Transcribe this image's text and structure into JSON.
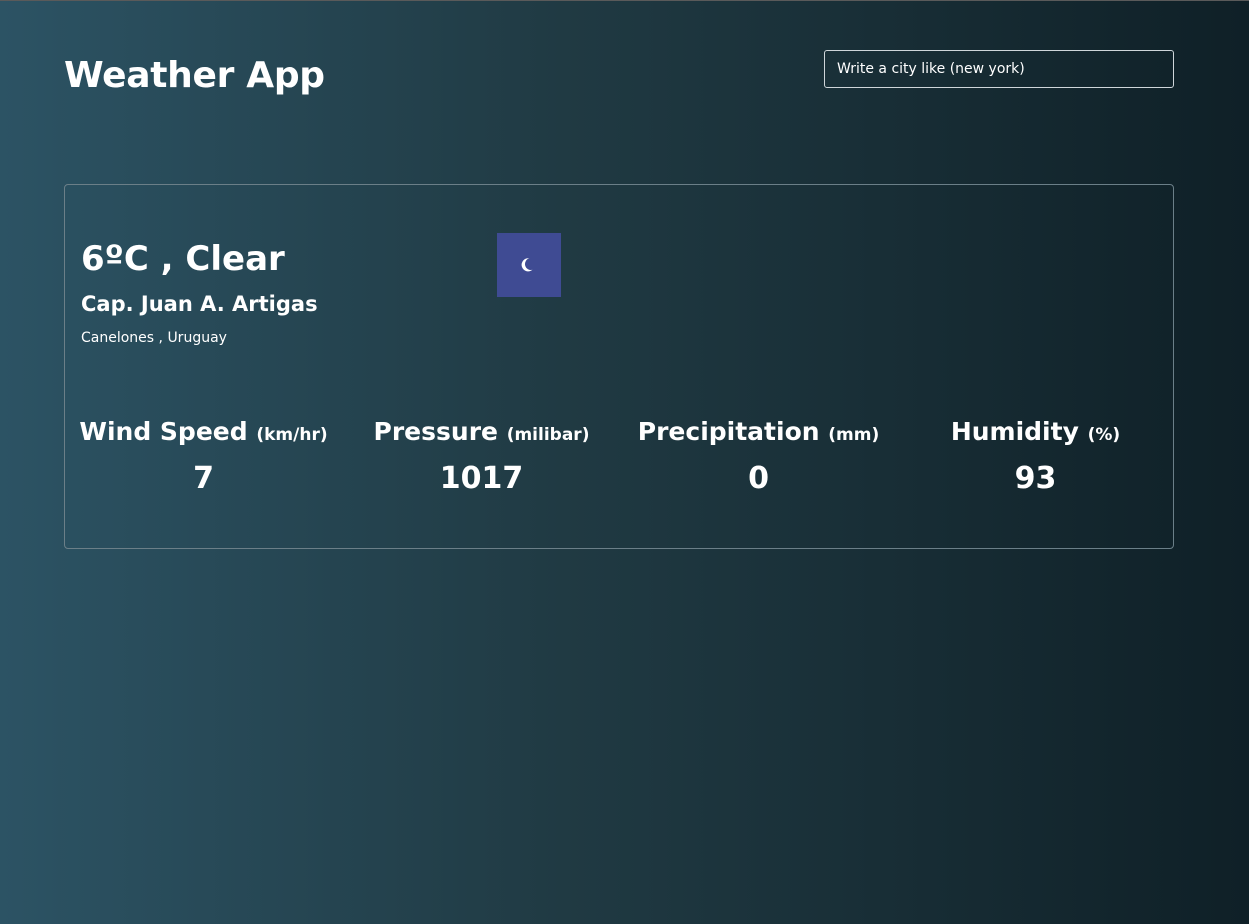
{
  "header": {
    "title": "Weather App"
  },
  "search": {
    "placeholder": "Write a city like (new york)"
  },
  "current": {
    "temperature": "6",
    "degree_symbol": "º",
    "unit": "C",
    "separator": " , ",
    "condition": "Clear",
    "city": "Cap. Juan A. Artigas",
    "region": "Canelones",
    "region_separator": " , ",
    "country": "Uruguay",
    "icon": {
      "name": "crescent-moon-icon",
      "background": "#3f4b93",
      "color": "#ffffff"
    }
  },
  "stats": [
    {
      "label": "Wind Speed",
      "unit": "(km/hr)",
      "value": "7"
    },
    {
      "label": "Pressure",
      "unit": "(milibar)",
      "value": "1017"
    },
    {
      "label": "Precipitation",
      "unit": "(mm)",
      "value": "0"
    },
    {
      "label": "Humidity",
      "unit": "(%)",
      "value": "93"
    }
  ],
  "colors": {
    "gradient_start": "#2c5364",
    "gradient_mid": "#203a43",
    "gradient_end": "#0f2027",
    "text": "#ffffff",
    "card_border": "#6b7f88"
  }
}
